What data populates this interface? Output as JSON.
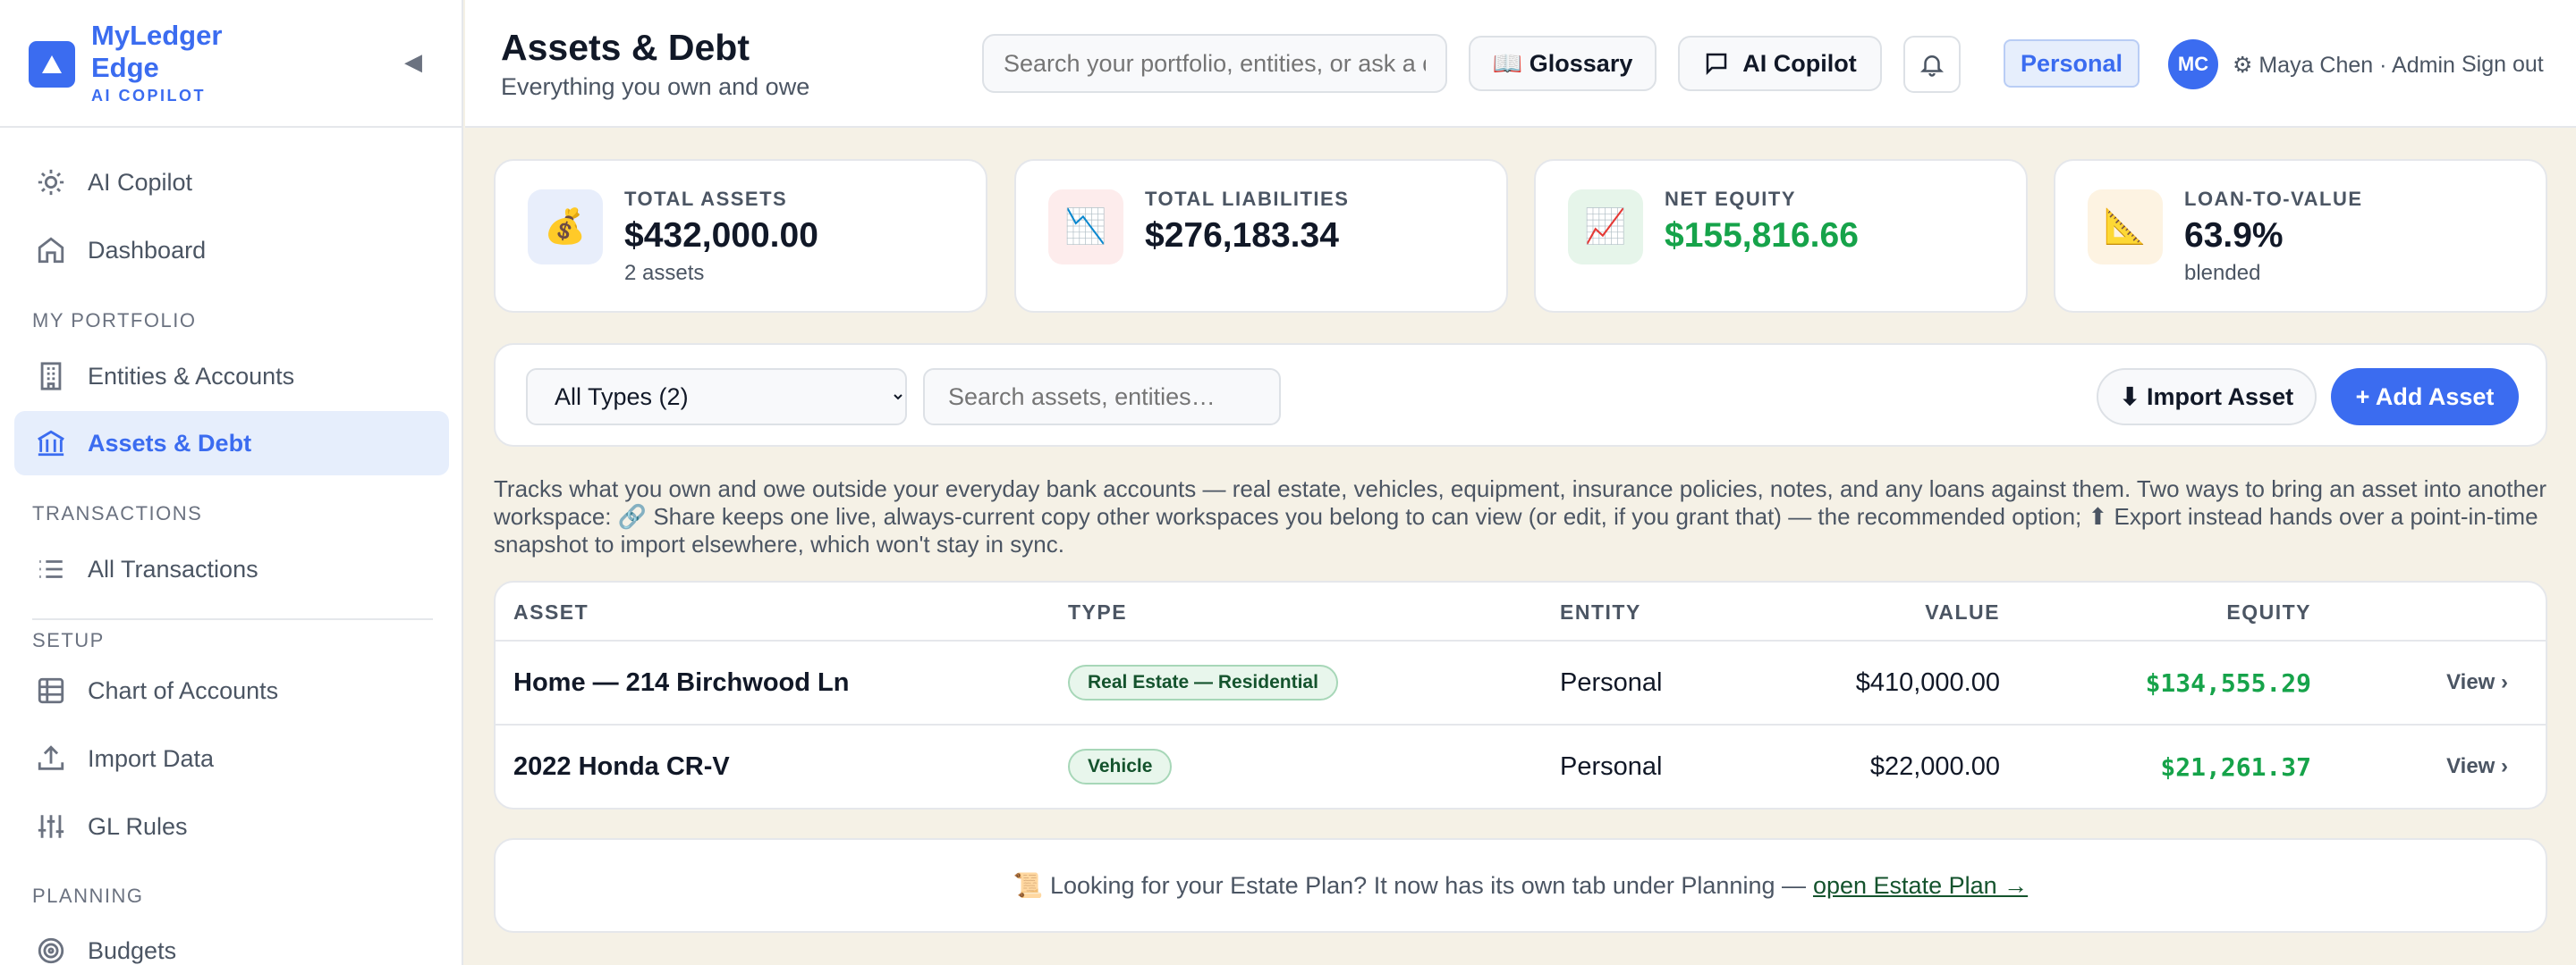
{
  "brand": {
    "name_line1": "MyLedger",
    "name_line2": "Edge",
    "subtitle": "AI COPILOT",
    "collapse_glyph": "◀",
    "accent_color": "#3b6cf0"
  },
  "sidebar": {
    "top_items": [
      {
        "label": "AI Copilot",
        "icon": "sun-icon"
      },
      {
        "label": "Dashboard",
        "icon": "home-icon"
      }
    ],
    "sections": [
      {
        "label": "MY PORTFOLIO",
        "items": [
          {
            "label": "Entities & Accounts",
            "icon": "building-icon"
          },
          {
            "label": "Assets & Debt",
            "icon": "bank-icon",
            "active": true
          }
        ]
      },
      {
        "label": "TRANSACTIONS",
        "items": [
          {
            "label": "All Transactions",
            "icon": "list-icon"
          }
        ]
      },
      {
        "label": "SETUP",
        "items": [
          {
            "label": "Chart of Accounts",
            "icon": "table-icon"
          },
          {
            "label": "Import Data",
            "icon": "upload-icon"
          },
          {
            "label": "GL Rules",
            "icon": "sliders-icon"
          }
        ]
      },
      {
        "label": "PLANNING",
        "items": [
          {
            "label": "Budgets",
            "icon": "target-icon"
          }
        ]
      }
    ]
  },
  "header": {
    "title": "Assets & Debt",
    "subtitle": "Everything you own and owe",
    "search_placeholder": "Search your portfolio, entities, or ask a question",
    "glossary_label": "📖 Glossary",
    "copilot_label": "AI Copilot",
    "workspace": "Personal",
    "avatar_initials": "MC",
    "user": "⚙ Maya Chen · Admin",
    "signout": "Sign out"
  },
  "stats": [
    {
      "label": "TOTAL ASSETS",
      "value": "$432,000.00",
      "sub": "2 assets",
      "icon": "💰",
      "icon_bg": "#e8eefb"
    },
    {
      "label": "TOTAL LIABILITIES",
      "value": "$276,183.34",
      "sub": "",
      "icon": "📉",
      "icon_bg": "#fdecec"
    },
    {
      "label": "NET EQUITY",
      "value": "$155,816.66",
      "sub": "",
      "icon": "📈",
      "icon_bg": "#e6f5ea"
    },
    {
      "label": "LOAN-TO-VALUE",
      "value": "63.9%",
      "sub": "blended",
      "icon": "📐",
      "icon_bg": "#fdf3e2"
    }
  ],
  "toolbar": {
    "type_filter": "All Types (2)",
    "search_placeholder": "Search assets, entities…",
    "import_label": "⬇ Import Asset",
    "add_label": "+ Add Asset"
  },
  "description": "Tracks what you own and owe outside your everyday bank accounts — real estate, vehicles, equipment, insurance policies, notes, and any loans against them. Two ways to bring an asset into another workspace: 🔗 Share keeps one live, always-current copy other workspaces you belong to can view (or edit, if you grant that) — the recommended option; ⬆ Export instead hands over a point-in-time snapshot to import elsewhere, which won't stay in sync.",
  "table": {
    "columns": [
      "ASSET",
      "TYPE",
      "ENTITY",
      "VALUE",
      "EQUITY"
    ],
    "rows": [
      {
        "asset": "Home — 214 Birchwood Ln",
        "type": "Real Estate — Residential",
        "entity": "Personal",
        "value": "$410,000.00",
        "equity": "$134,555.29",
        "action": "View ›"
      },
      {
        "asset": "2022 Honda CR-V",
        "type": "Vehicle",
        "entity": "Personal",
        "value": "$22,000.00",
        "equity": "$21,261.37",
        "action": "View ›"
      }
    ]
  },
  "estate_notice": {
    "text": "📜 Looking for your Estate Plan? It now has its own tab under Planning —",
    "link": "open Estate Plan →"
  }
}
